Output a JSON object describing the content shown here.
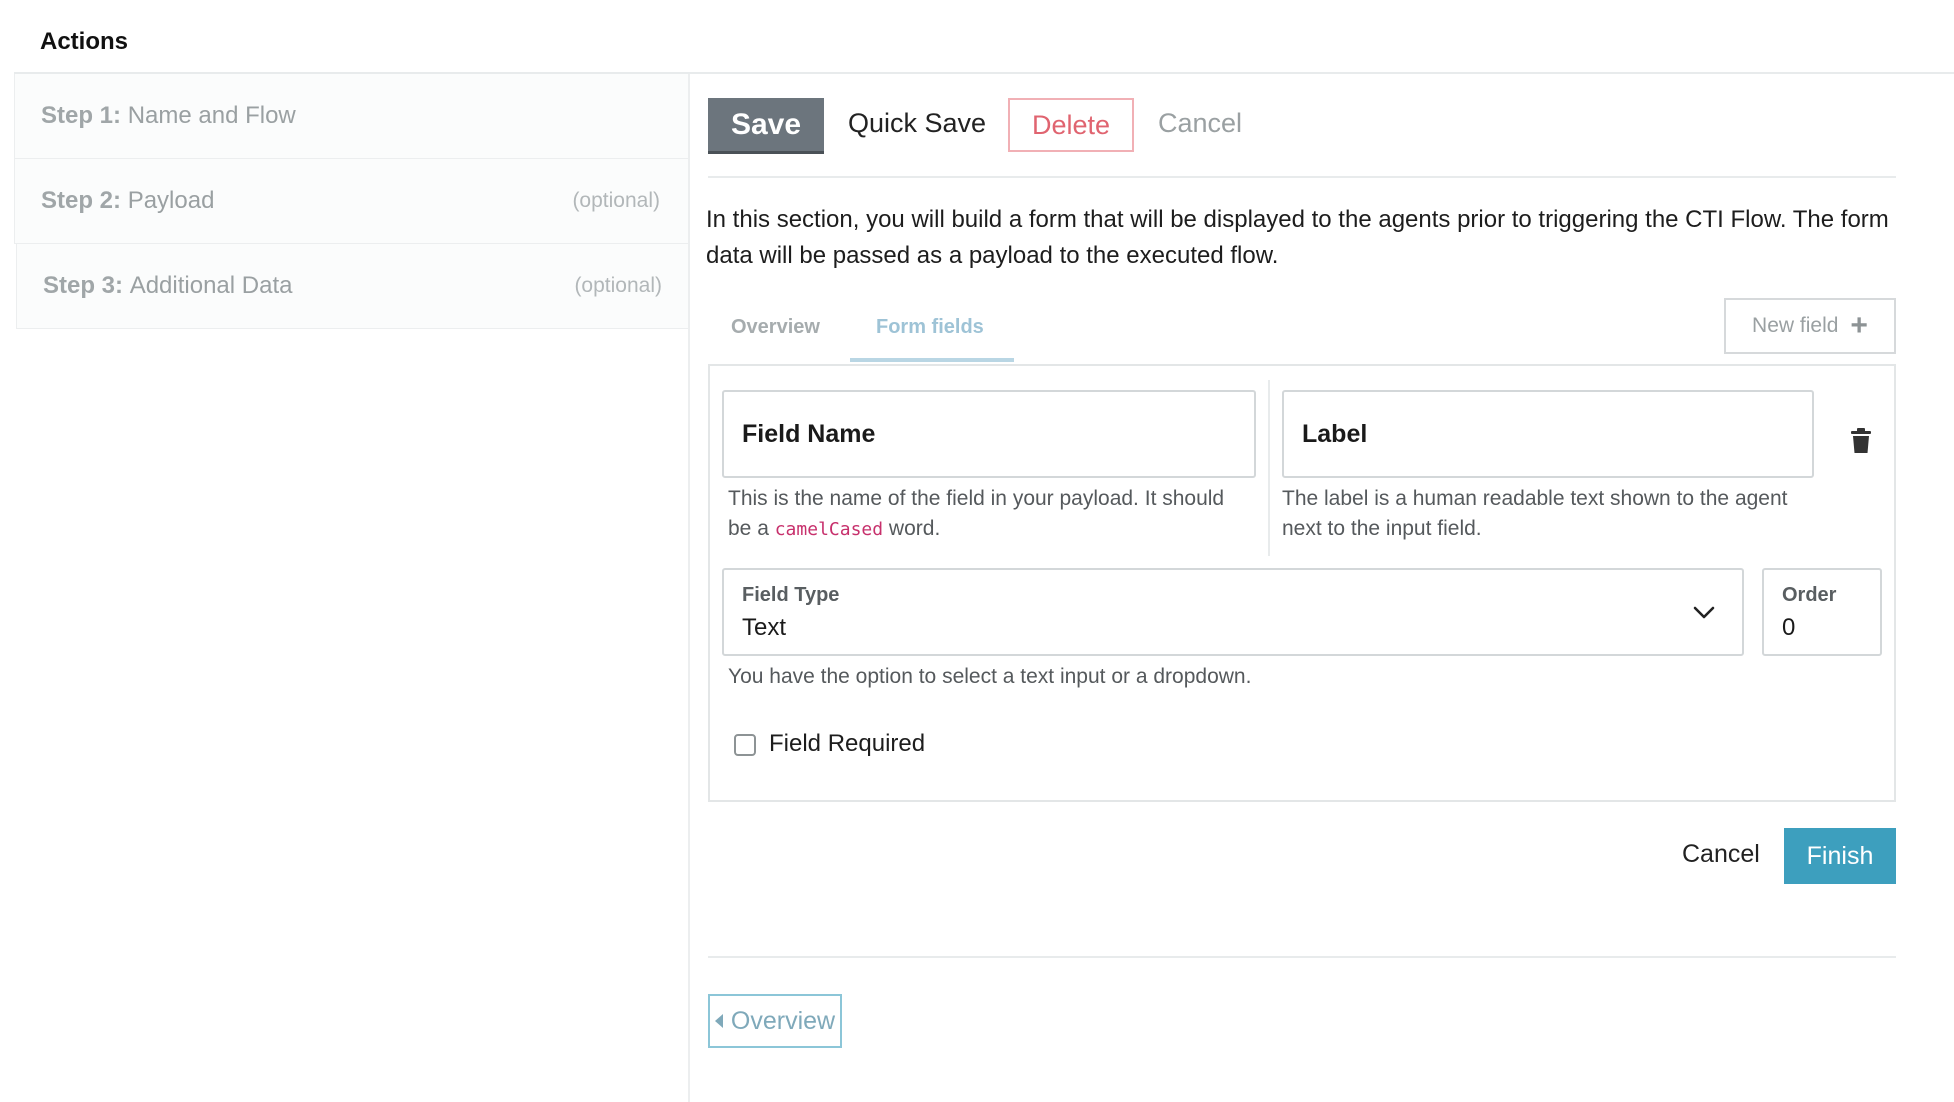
{
  "header": {
    "title": "Actions"
  },
  "steps": [
    {
      "number": "Step 1:",
      "name": "Name and Flow",
      "optional": ""
    },
    {
      "number": "Step 2:",
      "name": "Payload",
      "optional": "(optional)"
    },
    {
      "number": "Step 3:",
      "name": "Additional Data",
      "optional": "(optional)"
    }
  ],
  "toolbar": {
    "save_label": "Save",
    "quick_save_label": "Quick Save",
    "delete_label": "Delete",
    "cancel_label": "Cancel"
  },
  "intro_text": "In this section, you will build a form that will be displayed to the agents prior to triggering the CTI Flow. The form data will be passed as a payload to the executed flow.",
  "tabs": [
    {
      "label": "Overview",
      "active": false
    },
    {
      "label": "Form fields",
      "active": true
    }
  ],
  "new_field_label": "New field",
  "form": {
    "field_name": {
      "label": "Field Name",
      "help_before": "This is the name of the field in your payload. It should be a ",
      "help_code": "camelCased",
      "help_after": " word."
    },
    "label_field": {
      "label": "Label",
      "help": "The label is a human readable text shown to the agent next to the input field."
    },
    "field_type": {
      "label": "Field Type",
      "value": "Text",
      "help": "You have the option to select a text input or a dropdown."
    },
    "order": {
      "label": "Order",
      "value": "0"
    },
    "required": {
      "label": "Field Required",
      "checked": false
    }
  },
  "footer": {
    "cancel_label": "Cancel",
    "finish_label": "Finish",
    "back_label": "Overview"
  },
  "colors": {
    "accent": "#3d9fbe",
    "save": "#6c757d",
    "delete": "#e06470",
    "code": "#c7306c"
  },
  "icons": [
    "plus-icon",
    "trash-icon",
    "chevron-down-icon",
    "caret-left-icon"
  ]
}
